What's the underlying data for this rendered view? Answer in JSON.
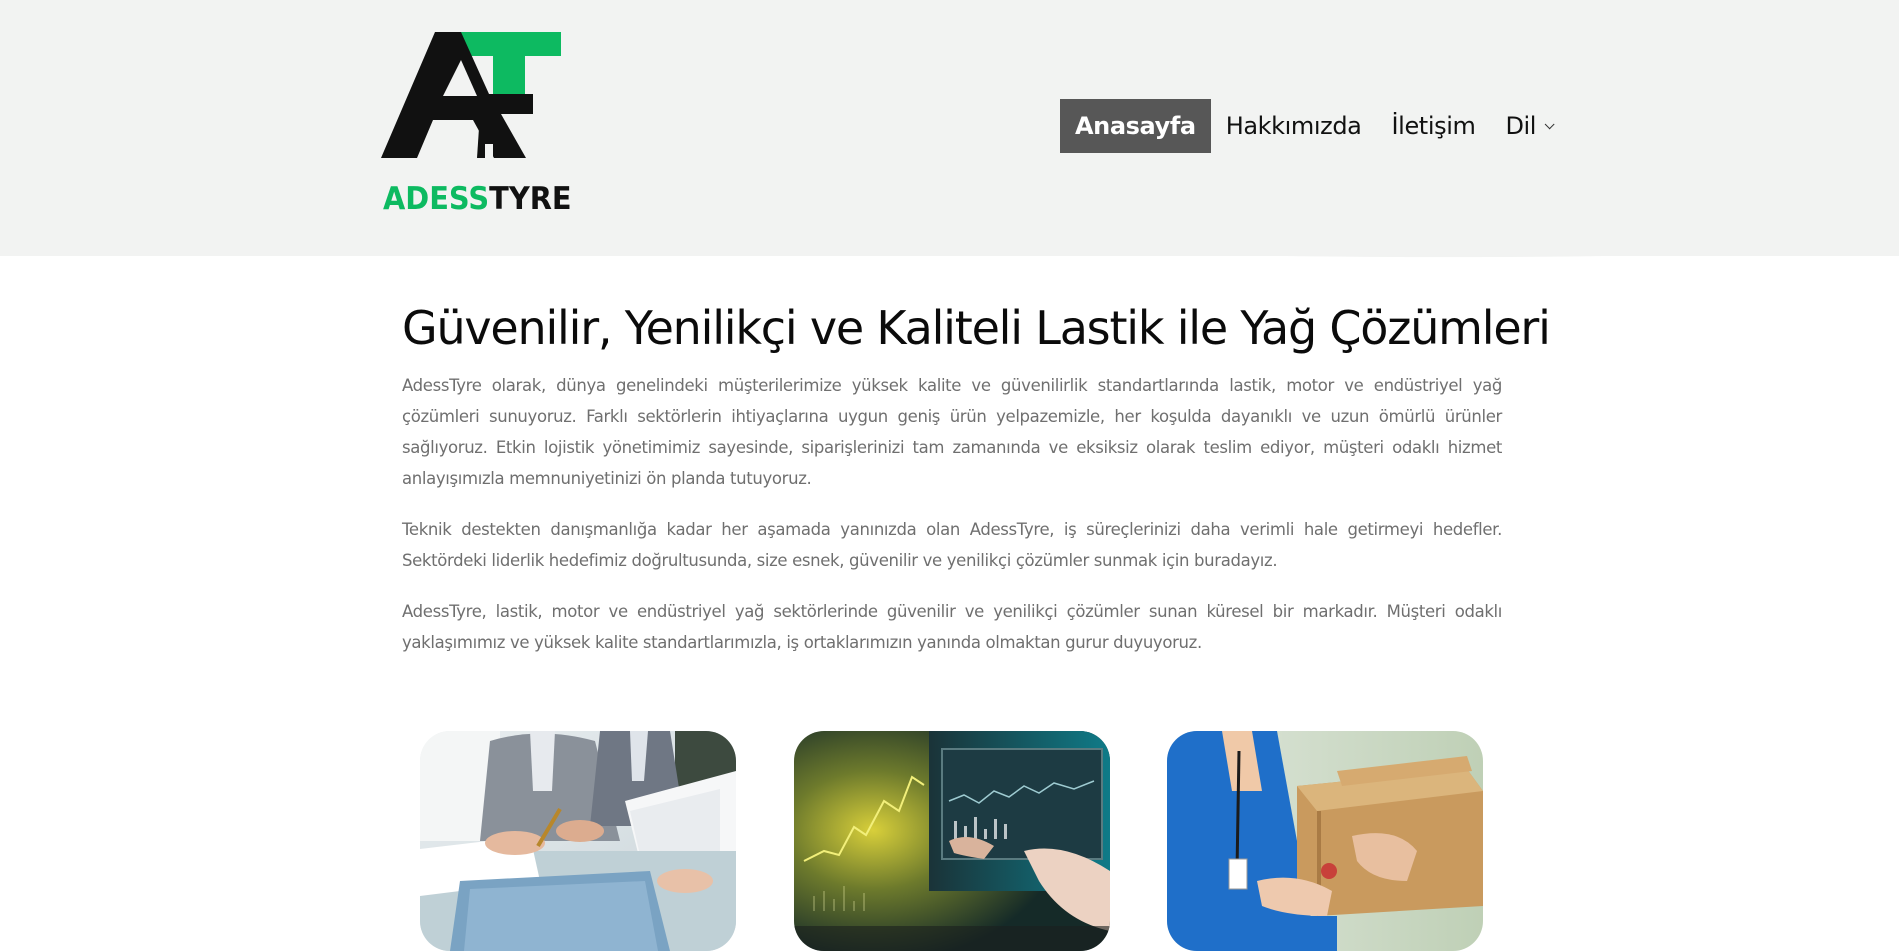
{
  "brand": {
    "wordmark_green": "ADESS",
    "wordmark_black": "TYRE",
    "accent_color": "#0dba61",
    "logo_icon": "at-monogram-logo"
  },
  "nav": {
    "items": [
      {
        "label": "Anasayfa",
        "active": true
      },
      {
        "label": "Hakkımızda",
        "active": false
      },
      {
        "label": "İletişim",
        "active": false
      },
      {
        "label": "Dil",
        "active": false,
        "icon": "chevron-down-icon"
      }
    ],
    "active_bg": "#575757"
  },
  "main": {
    "title": "Güvenilir, Yenilikçi ve Kaliteli Lastik ile Yağ Çözümleri",
    "paragraphs": [
      "AdessTyre olarak, dünya genelindeki müşterilerimize yüksek kalite ve güvenilirlik standartlarında lastik, motor ve endüstriyel yağ çözümleri sunuyoruz. Farklı sektörlerin ihtiyaçlarına uygun geniş ürün yelpazemizle, her koşulda dayanıklı ve uzun ömürlü ürünler sağlıyoruz. Etkin lojistik yönetimimiz sayesinde, siparişlerinizi tam zamanında ve eksiksiz olarak teslim ediyor, müşteri odaklı hizmet anlayışımızla memnuniyetinizi ön planda tutuyoruz.",
      "Teknik destekten danışmanlığa kadar her aşamada yanınızda olan AdessTyre, iş süreçlerinizi daha verimli hale getirmeyi hedefler. Sektördeki liderlik hedefimiz doğrultusunda, size esnek, güvenilir ve yenilikçi çözümler sunmak için buradayız.",
      "AdessTyre, lastik, motor ve endüstriyel yağ sektörlerinde güvenilir ve yenilikçi çözümler sunan küresel bir markadır. Müşteri odaklı yaklaşımımız ve yüksek kalite standartlarımızla, iş ortaklarımızın yanında olmaktan gurur duyuyoruz."
    ]
  },
  "cards": [
    {
      "image": "business-meeting-photo"
    },
    {
      "image": "stock-chart-screens-photo"
    },
    {
      "image": "package-delivery-photo"
    }
  ]
}
